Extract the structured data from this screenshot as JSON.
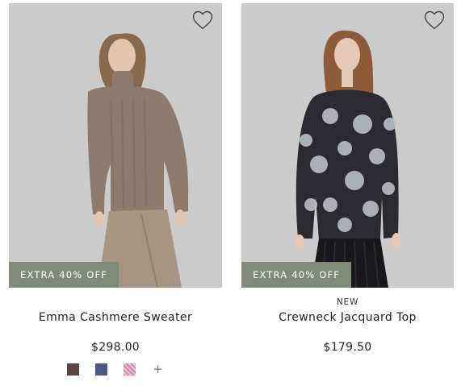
{
  "products": [
    {
      "name": "Emma Cashmere Sweater",
      "price": "$298.00",
      "tag": "",
      "badge": "EXTRA 40% OFF",
      "image_icon": "model-in-taupe-sweater-image",
      "swatches": [
        {
          "color": "#5a4640",
          "name": "dark-brown"
        },
        {
          "color": "#4a5a7e",
          "name": "navy-blue"
        },
        {
          "color": "#c98aa8",
          "name": "pink-pattern"
        }
      ],
      "more_swatches_label": "+"
    },
    {
      "name": "Crewneck Jacquard Top",
      "price": "$179.50",
      "tag": "NEW",
      "badge": "EXTRA 40% OFF",
      "image_icon": "model-in-floral-jacquard-top-image",
      "swatches": [],
      "more_swatches_label": ""
    }
  ],
  "colors": {
    "badge_bg": "#7f8a7b",
    "image_bg": "#c9c9c9",
    "text": "#222222"
  },
  "icons": {
    "favorite": "heart-outline-icon"
  }
}
